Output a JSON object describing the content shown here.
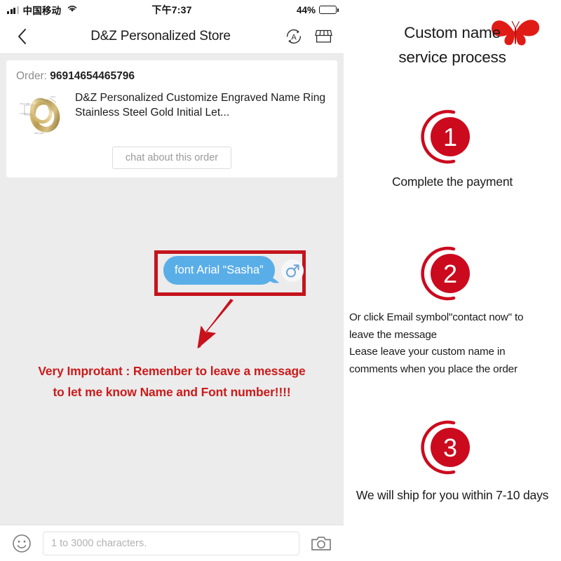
{
  "statusbar": {
    "carrier": "中国移动",
    "time": "下午7:37",
    "battery_pct": "44%",
    "battery_level": 44,
    "signal_icon": "signal-bars-icon",
    "wifi_icon": "wifi-icon",
    "battery_icon": "battery-icon"
  },
  "navbar": {
    "back_icon": "chevron-left-icon",
    "title": "D&Z Personalized Store",
    "translate_icon": "translate-icon",
    "store_icon": "storefront-icon"
  },
  "order_card": {
    "order_label": "Order:",
    "order_number": "96914654465796",
    "product_thumb_icon": "gold-ring-product-image",
    "product_title": "D&Z Personalized Customize Engraved Name Ring Stainless Steel Gold Initial Let...",
    "chat_button_label": "chat about this order"
  },
  "message": {
    "bubble_text": "font Arial “Sasha”",
    "bubble_color": "#5aaee8",
    "avatar_icon": "mars-symbol-avatar-icon",
    "highlight_box_color": "#c4141d",
    "arrow_icon": "red-down-left-arrow-icon"
  },
  "warning": {
    "line1": "Very Improtant : Remenber to leave a message",
    "line2": "to let me know Name and Font number!!!!",
    "color": "#cc1a1a"
  },
  "inputbar": {
    "emoji_icon": "smiley-face-icon",
    "placeholder": "1 to 3000 characters.",
    "value": "",
    "camera_icon": "camera-icon"
  },
  "info_panel": {
    "heading_line1": "Custom name",
    "heading_line2": "service process",
    "butterfly_icon": "red-butterfly-icon",
    "accent_color": "#cc0a1e",
    "steps": [
      {
        "number": "1",
        "caption": "Complete the payment",
        "paragraph": ""
      },
      {
        "number": "2",
        "caption": "",
        "paragraph": "Or click Email symbol\"contact now\" to leave the message\nLease leave your custom name in comments when you place the order"
      },
      {
        "number": "3",
        "caption": "We will ship for you within 7-10 days",
        "paragraph": ""
      }
    ],
    "step2_lines": [
      "Or click Email symbol\"contact now\" to",
      "leave the message",
      "Lease leave your custom name in",
      "comments when you place the order"
    ]
  }
}
